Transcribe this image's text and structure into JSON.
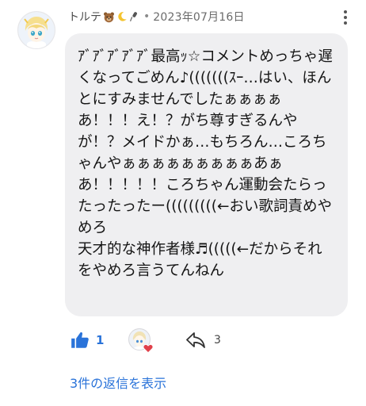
{
  "comment": {
    "author": "トルテ",
    "separator": "•",
    "date": "2023年07月16日",
    "text": "ｱﾞｱﾞｱﾞｱﾞｱﾞ最高ｯ☆コメントめっちゃ遅くなってごめん♪(((((((ｽｰ…はい、ほんとにすみませんでしたぁぁぁぁあ！！！え！？がち尊すぎるんやが！？メイドかぁ…もちろん…ころちゃんやぁぁぁぁぁぁぁぁぁあぁあ！！！！！ころちゃん運動会たらったったったー(((((((((←おい歌詞責めやめろ\n天才的な神作者様♬(((((←だからそれをやめろ言うてんねん",
    "like_count": "1",
    "share_count": "3",
    "replies_label": "3件の返信を表示"
  },
  "icons": {
    "author_emoji_1": "bear-face-icon",
    "author_emoji_2": "crescent-moon-icon",
    "author_emoji_3": "microphone-icon",
    "more": "more-vertical-icon",
    "like": "thumbs-up-icon",
    "heart": "heart-icon",
    "share": "share-arrow-icon"
  },
  "colors": {
    "accent": "#2a73d9",
    "bubble": "#efeff1",
    "heart": "#e0404a"
  }
}
